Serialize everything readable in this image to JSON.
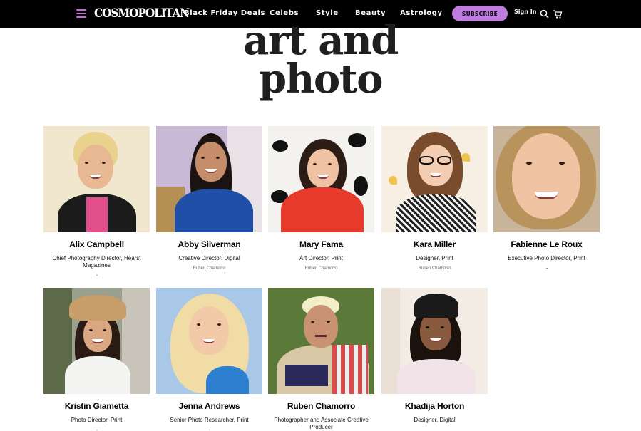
{
  "nav": {
    "logo": "COSMOPOLITAN",
    "links": [
      "Black Friday Deals",
      "Celebs",
      "Style",
      "Beauty",
      "Astrology"
    ],
    "subscribe": "SUBSCRIBE",
    "signin": "Sign In"
  },
  "heading": {
    "line1": "art and",
    "line2": "photo"
  },
  "people": [
    {
      "name": "Alix Campbell",
      "role": "Chief Photography Director, Hearst Magazines",
      "credit": ""
    },
    {
      "name": "Abby Silverman",
      "role": "Creative Director, Digital",
      "credit": "Ruben Chamorro"
    },
    {
      "name": "Mary Fama",
      "role": "Art Director, Print",
      "credit": "Ruben Chamorro"
    },
    {
      "name": "Kara Miller",
      "role": "Designer, Print",
      "credit": "Ruben Chamorro"
    },
    {
      "name": "Fabienne Le Roux",
      "role": "Executive Photo Director, Print",
      "credit": ""
    },
    {
      "name": "Kristin Giametta",
      "role": "Photo Director, Print",
      "credit": ""
    },
    {
      "name": "Jenna Andrews",
      "role": "Senior Photo Researcher, Print",
      "credit": ""
    },
    {
      "name": "Ruben Chamorro",
      "role": "Photographer and Associate Creative Producer",
      "credit": ""
    },
    {
      "name": "Khadija Horton",
      "role": "Designer, Digital",
      "credit": ""
    }
  ],
  "colors": {
    "nav_bg": "#000000",
    "subscribe_bg": "#c07de0",
    "accent": "#c26ad8"
  },
  "icons": [
    "menu-icon",
    "search-icon",
    "cart-icon"
  ]
}
